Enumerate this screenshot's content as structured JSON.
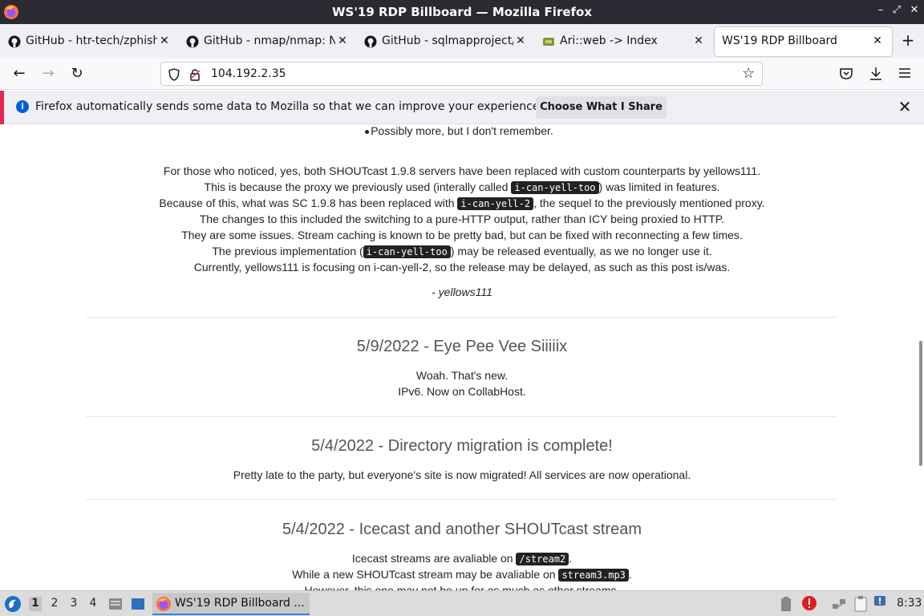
{
  "window": {
    "title": "WS'19 RDP Billboard — Mozilla Firefox"
  },
  "tabs": [
    {
      "label": "GitHub - htr-tech/zphisher",
      "icon": "github-icon"
    },
    {
      "label": "GitHub - nmap/nmap: Nmap",
      "icon": "github-icon"
    },
    {
      "label": "GitHub - sqlmapproject/sqlmap",
      "icon": "github-icon"
    },
    {
      "label": "Ari::web -> Index",
      "icon": "site-icon"
    },
    {
      "label": "WS'19 RDP Billboard",
      "icon": "none",
      "active": true
    }
  ],
  "navbar": {
    "url": "104.192.2.35"
  },
  "notification": {
    "message": "Firefox automatically sends some data to Mozilla so that we can improve your experience.",
    "button": "Choose What I Share"
  },
  "content": {
    "bullet_item": "Possibly more, but I don't remember.",
    "para": {
      "l1": "For those who noticed, yes, both SHOUTcast 1.9.8 servers have been replaced with custom counterparts by yellows111.",
      "l2a": "This is because the proxy we previously used (interally called ",
      "l2code": "i-can-yell-too",
      "l2b": ") was limited in features.",
      "l3a": "Because of this, what was SC 1.9.8 has been replaced with ",
      "l3code": "i-can-yell-2",
      "l3b": ", the sequel to the previously mentioned proxy.",
      "l4": "The changes to this included the switching to a pure-HTTP output, rather than ICY being proxied to HTTP.",
      "l5": "They are some issues. Stream caching is known to be pretty bad, but can be fixed with reconnecting a few times.",
      "l6a": "The previous implementation (",
      "l6code": "i-can-yell-too",
      "l6b": ") may be released eventually, as we no longer use it.",
      "l7": "Currently, yellows111 is focusing on i-can-yell-2, so the release may be delayed, as such as this post is/was.",
      "signature": "- yellows111"
    },
    "posts": [
      {
        "title": "5/9/2022 - Eye Pee Vee Siiiiix",
        "lines": [
          "Woah. That's new.",
          "IPv6. Now on CollabHost."
        ]
      },
      {
        "title": "5/4/2022 - Directory migration is complete!",
        "lines": [
          "Pretty late to the party, but everyone's site is now migrated! All services are now operational."
        ]
      },
      {
        "title": "5/4/2022 - Icecast and another SHOUTcast stream",
        "l1a": "Icecast streams are avaliable on ",
        "l1code": "/stream2",
        "l1b": ".",
        "l2a": "While a new SHOUTcast stream may be avaliable on ",
        "l2code": "stream3.mp3",
        "l2b": ".",
        "l3": "However, this one may not be up for as much as other streams."
      }
    ]
  },
  "taskbar": {
    "workspaces": [
      "1",
      "2",
      "3",
      "4"
    ],
    "app_label": "WS'19 RDP Billboard ...",
    "clock": "8:33"
  },
  "colors": {
    "titlebar": "#2b2a33",
    "accent": "#0060df",
    "code_bg": "#222222"
  }
}
